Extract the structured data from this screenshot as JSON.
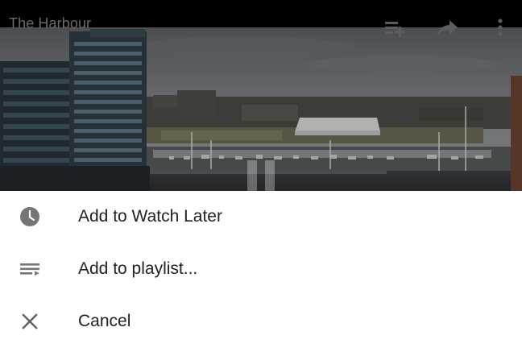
{
  "player": {
    "title": "The Harbour",
    "icons": [
      "add-to-playlist-icon",
      "share-icon",
      "more-vert-icon",
      "pause-icon"
    ],
    "overlay_icon_color": "#ffffff"
  },
  "menu": {
    "items": [
      {
        "label": "Add to Watch Later",
        "icon": "clock-icon"
      },
      {
        "label": "Add to playlist...",
        "icon": "playlist-icon"
      },
      {
        "label": "Cancel",
        "icon": "close-icon"
      }
    ],
    "icon_color": "#757575",
    "text_color": "#212121"
  }
}
